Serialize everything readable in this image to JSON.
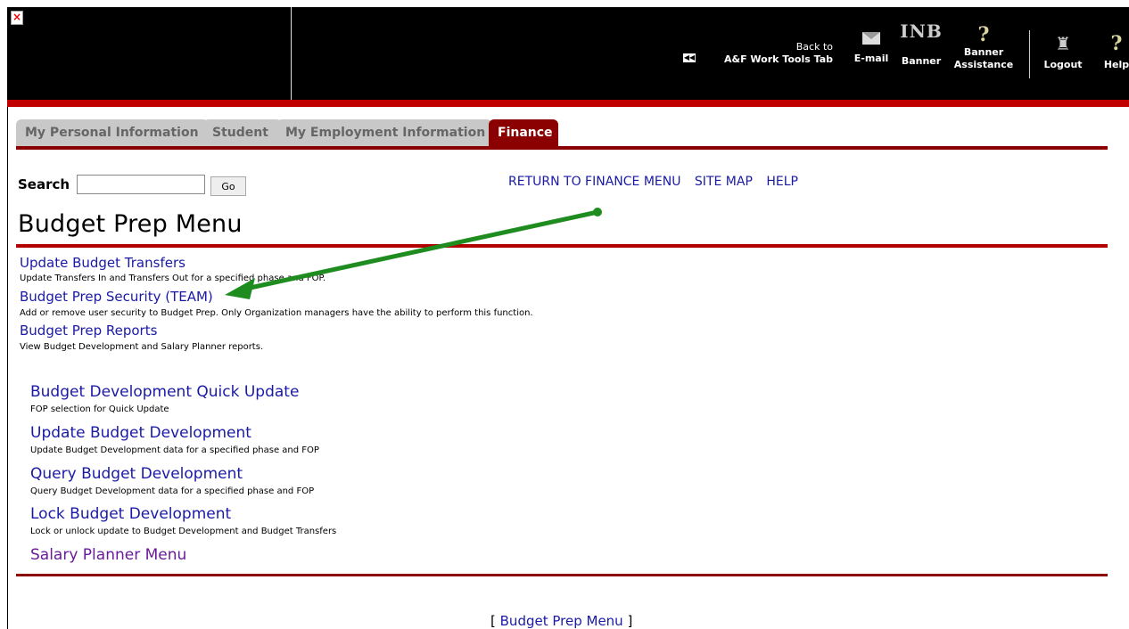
{
  "header": {
    "back_line1": "Back to",
    "back_line2": "A&F Work Tools Tab",
    "email_label": "E-mail",
    "inb_text": "INB",
    "banner_label": "Banner",
    "assist_line1": "Banner",
    "assist_line2": "Assistance",
    "logout_label": "Logout",
    "help_label": "Help",
    "broken_image_glyph": "×"
  },
  "tabs": [
    {
      "label": "My Personal Information",
      "active": false
    },
    {
      "label": "Student",
      "active": false
    },
    {
      "label": "My Employment Information",
      "active": false
    },
    {
      "label": "Finance",
      "active": true
    }
  ],
  "search": {
    "label": "Search",
    "value": "",
    "go_label": "Go"
  },
  "top_links": {
    "return": "RETURN TO FINANCE MENU",
    "site_map": "SITE MAP",
    "help": "HELP"
  },
  "page_title": "Budget Prep Menu",
  "menu": [
    {
      "label": "Update Budget Transfers",
      "desc": "Update Transfers In and Transfers Out for a specified phase and FOP."
    },
    {
      "label": "Budget Prep Security (TEAM)",
      "desc": "Add or remove user security to Budget Prep. Only Organization managers have the ability to perform this function."
    },
    {
      "label": "Budget Prep Reports",
      "desc": "View Budget Development and Salary Planner reports."
    }
  ],
  "submenu": [
    {
      "label": "Budget Development Quick Update",
      "desc": "FOP selection for Quick Update"
    },
    {
      "label": "Update Budget Development",
      "desc": "Update Budget Development data for a specified phase and FOP"
    },
    {
      "label": "Query Budget Development",
      "desc": "Query Budget Development data for a specified phase and FOP"
    },
    {
      "label": "Lock Budget Development",
      "desc": "Lock or unlock update to Budget Development and Budget Transfers"
    },
    {
      "label": "Salary Planner Menu",
      "desc": ""
    }
  ],
  "footer": {
    "open_bracket": "[",
    "link": "Budget Prep Menu",
    "close_bracket": "]"
  },
  "colors": {
    "header_bg": "#000000",
    "accent_red": "#c00000",
    "tab_active": "#8b0000",
    "link_blue": "#1a1aa6",
    "visited_purple": "#6a1b9a",
    "annotation_green": "#1e8c1e"
  }
}
